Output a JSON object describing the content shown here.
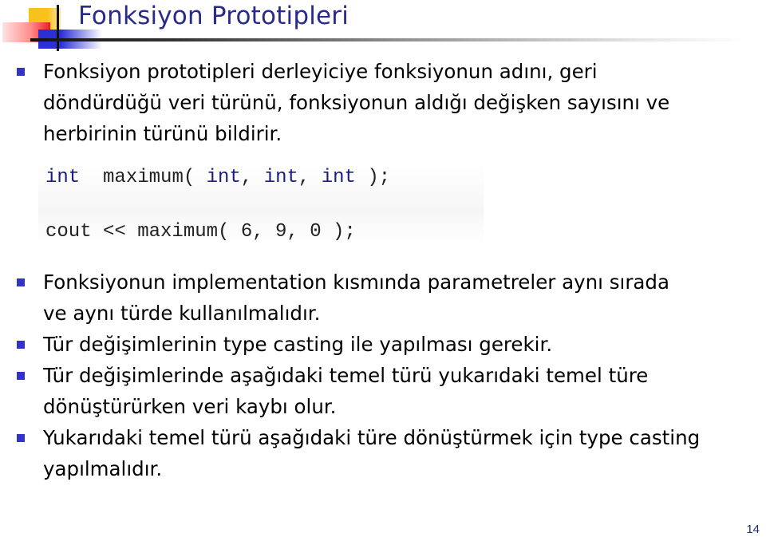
{
  "slide": {
    "title": "Fonksiyon Prototipleri",
    "bullets_top": [
      {
        "text": "Fonksiyon prototipleri derleyiciye fonksiyonun adını, geri döndürdüğü veri türünü, fonksiyonun aldığı değişken sayısını ve herbirinin türünü bildirir."
      }
    ],
    "code": {
      "line1": {
        "type1": "int",
        "name": "  maximum( ",
        "type2": "int",
        "sep1": ", ",
        "type3": "int",
        "sep2": ", ",
        "type4": "int",
        "end": " );"
      },
      "line2": "cout << maximum( 6, 9, 0 );"
    },
    "bullets_bottom": [
      {
        "text": "Fonksiyonun implementation kısmında parametreler aynı sırada ve aynı türde kullanılmalıdır."
      },
      {
        "text": "Tür değişimlerinin type casting ile yapılması gerekir."
      },
      {
        "text": "Tür değişimlerinde aşağıdaki temel türü yukarıdaki temel türe dönüştürürken veri kaybı olur."
      },
      {
        "text": "Yukarıdaki temel türü aşağıdaki türe dönüştürmek için type casting yapılmalıdır."
      }
    ],
    "page_number": "14",
    "colors": {
      "title": "#2a2a8a",
      "bullet": "#3333cc",
      "keyword": "#1a1a88"
    }
  }
}
